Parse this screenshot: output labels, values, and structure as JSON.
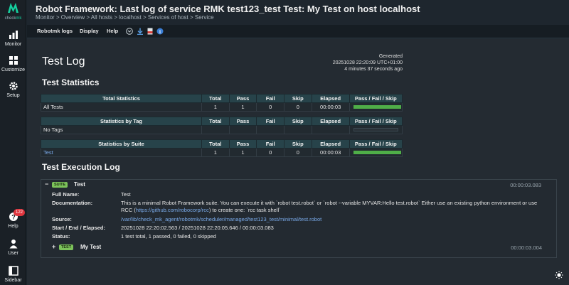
{
  "sidebar": {
    "logo_text_a": "check",
    "logo_text_b": "mk",
    "items": [
      {
        "label": "Monitor",
        "icon": "monitor-icon"
      },
      {
        "label": "Customize",
        "icon": "customize-icon"
      },
      {
        "label": "Setup",
        "icon": "gear-icon"
      },
      {
        "label": "Help",
        "icon": "help-icon",
        "badge": "122"
      },
      {
        "label": "User",
        "icon": "user-icon"
      },
      {
        "label": "Sidebar",
        "icon": "sidebar-icon"
      }
    ]
  },
  "header": {
    "title": "Robot Framework: Last log of service RMK test123_test Test: My Test on host localhost",
    "breadcrumb": "Monitor > Overview > All hosts > localhost > Services of host > Service"
  },
  "menubar": {
    "items": [
      "Robotmk logs",
      "Display",
      "Help"
    ],
    "icons": [
      "collapse-icon",
      "download-icon",
      "pdf-icon",
      "info-icon"
    ]
  },
  "log": {
    "title": "Test Log",
    "generated_label": "Generated",
    "generated_time": "20251028 22:20:09 UTC+01:00",
    "generated_ago": "4 minutes 37 seconds ago"
  },
  "statistics": {
    "title": "Test Statistics",
    "columns": [
      "Total",
      "Pass",
      "Fail",
      "Skip",
      "Elapsed",
      "Pass / Fail / Skip"
    ],
    "total": {
      "header": "Total Statistics",
      "rows": [
        {
          "name": "All Tests",
          "total": "1",
          "pass": "1",
          "fail": "0",
          "skip": "0",
          "elapsed": "00:00:03",
          "pass_ratio": 1.0
        }
      ]
    },
    "tag": {
      "header": "Statistics by Tag",
      "rows": [
        {
          "name": "No Tags"
        }
      ]
    },
    "suite": {
      "header": "Statistics by Suite",
      "rows": [
        {
          "name": "Test",
          "total": "1",
          "pass": "1",
          "fail": "0",
          "skip": "0",
          "elapsed": "00:00:03",
          "pass_ratio": 1.0
        }
      ]
    }
  },
  "execution": {
    "title": "Test Execution Log",
    "suite": {
      "toggle": "−",
      "badge": "SUITE",
      "name": "Test",
      "time": "00:00:03.083",
      "full_name_key": "Full Name:",
      "full_name": "Test",
      "doc_key": "Documentation:",
      "doc_line1": "This is a minimal Robot Framework suite. You can execute it with `robot test.robot` or `robot --variable MYVAR:Hello test.robot` Either use an existing python environment or use",
      "doc_line2_a": "RCC (",
      "doc_line2_link": "https://github.com/robocorp/rcc",
      "doc_line2_b": ") to create one: `rcc task shell`",
      "source_key": "Source:",
      "source": "/var/lib/check_mk_agent/robotmk/scheduler/managed/test123_test/minimal/test.robot",
      "start_key": "Start / End / Elapsed:",
      "start": "20251028 22:20:02.563 / 20251028 22:20:05.646 / 00:00:03.083",
      "status_key": "Status:",
      "status": "1 test total, 1 passed, 0 failed, 0 skipped"
    },
    "test": {
      "toggle": "+",
      "badge": "TEST",
      "name": "My Test",
      "time": "00:00:03.004"
    }
  },
  "colors": {
    "pass": "#4fae48",
    "accent": "#15d1a0",
    "badge_red": "#e0353e"
  }
}
